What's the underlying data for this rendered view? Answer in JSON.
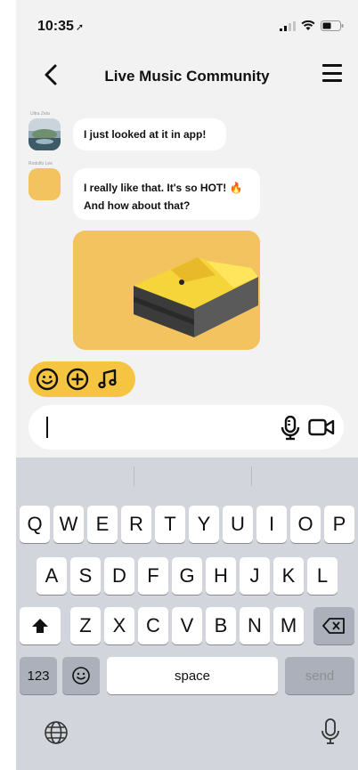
{
  "status_bar": {
    "time": "10:35",
    "location_arrow": "➚"
  },
  "header": {
    "title": "Live Music Community"
  },
  "messages": [
    {
      "sender": "Ultra Zeta",
      "text": "I just looked at it in app!"
    },
    {
      "sender": "Rodolfo Lee",
      "line1": "I really like that. It's so HOT! 🔥",
      "line2": "And how about that?"
    }
  ],
  "quick_actions": [
    "emoji-icon",
    "add-icon",
    "music-note-icon"
  ],
  "input": {
    "value": ""
  },
  "keyboard": {
    "row1": [
      "Q",
      "W",
      "E",
      "R",
      "T",
      "Y",
      "U",
      "I",
      "O",
      "P"
    ],
    "row2": [
      "A",
      "S",
      "D",
      "F",
      "G",
      "H",
      "J",
      "K",
      "L"
    ],
    "row3": [
      "Z",
      "X",
      "C",
      "V",
      "B",
      "N",
      "M"
    ],
    "numbers_key": "123",
    "space_key": "space",
    "send_key": "send"
  },
  "colors": {
    "accent": "#f5c542",
    "photo_bg": "#f3c35f",
    "keyboard_bg": "#d2d5db"
  }
}
